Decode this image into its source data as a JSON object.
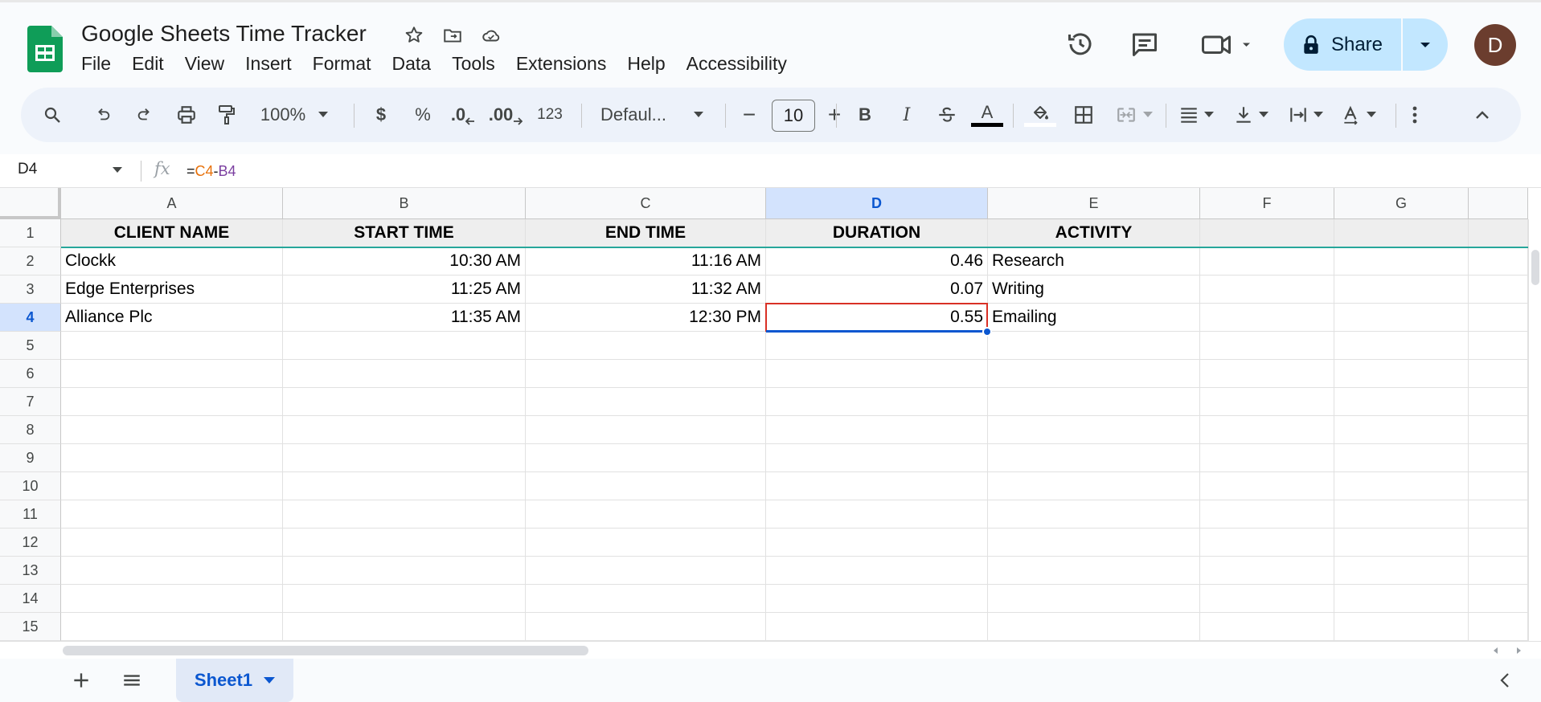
{
  "doc": {
    "title": "Google Sheets Time Tracker",
    "menu": [
      "File",
      "Edit",
      "View",
      "Insert",
      "Format",
      "Data",
      "Tools",
      "Extensions",
      "Help",
      "Accessibility"
    ],
    "share_label": "Share",
    "avatar_letter": "D"
  },
  "toolbar": {
    "zoom": "100%",
    "currency": "$",
    "percent": "%",
    "dec_decrease": ".0",
    "dec_increase": ".00",
    "more_formats": "123",
    "font": "Defaul...",
    "font_size": "10",
    "minus": "−",
    "plus": "+",
    "bold": "B",
    "italic": "I",
    "text_color": "A"
  },
  "formula_bar": {
    "cell_ref": "D4",
    "fx": "fx",
    "formula_eq": "=",
    "formula_ref1": "C4",
    "formula_op": "-",
    "formula_ref2": "B4"
  },
  "grid": {
    "columns": [
      "A",
      "B",
      "C",
      "D",
      "E",
      "F",
      "G"
    ],
    "rows": [
      "1",
      "2",
      "3",
      "4",
      "5",
      "6",
      "7",
      "8",
      "9",
      "10",
      "11",
      "12",
      "13",
      "14",
      "15"
    ],
    "selected_column": "D",
    "selected_row": "4",
    "header_row": [
      "CLIENT NAME",
      "START TIME",
      "END TIME",
      "DURATION",
      "ACTIVITY"
    ],
    "data_rows": [
      [
        "Clockk",
        "10:30 AM",
        "11:16 AM",
        "0.46",
        "Research"
      ],
      [
        "Edge Enterprises",
        "11:25 AM",
        "11:32 AM",
        "0.07",
        "Writing"
      ],
      [
        "Alliance Plc",
        "11:35 AM",
        "12:30 PM",
        "0.55",
        "Emailing"
      ]
    ]
  },
  "sheets": {
    "active": "Sheet1"
  },
  "colors": {
    "accent": "#0b57d0",
    "share_bg": "#c2e7ff",
    "selection": "#d93025",
    "formula_ref1": "#e8710a",
    "formula_ref2": "#7b3fa0",
    "sheets_logo": "#0f9d58"
  }
}
